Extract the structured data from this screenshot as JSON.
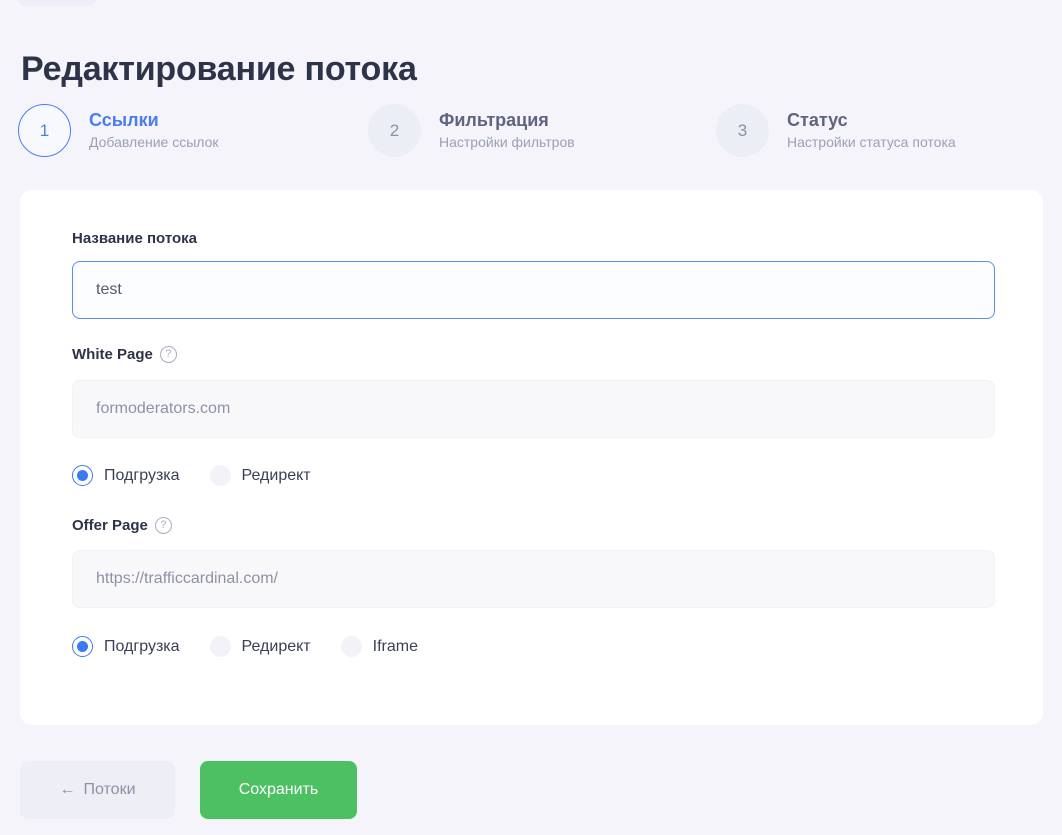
{
  "page": {
    "title": "Редактирование потока",
    "background_color": "#f4f4fa",
    "card_color": "#ffffff"
  },
  "stepper": {
    "steps": [
      {
        "number": "1",
        "title": "Ссылки",
        "subtitle": "Добавление ссылок",
        "state": "active",
        "accent_color": "#4a7ef0"
      },
      {
        "number": "2",
        "title": "Фильтрация",
        "subtitle": "Настройки фильтров",
        "state": "inactive",
        "accent_color": "#8b90a6"
      },
      {
        "number": "3",
        "title": "Статус",
        "subtitle": "Настройки статуса потока",
        "state": "inactive",
        "accent_color": "#8b90a6"
      }
    ]
  },
  "form": {
    "flow_name": {
      "label": "Название потока",
      "value": "test",
      "placeholder": "Название потока",
      "focused": true
    },
    "white_page": {
      "label": "White Page",
      "help_icon": "question-circle-icon",
      "value": "formoderators.com",
      "placeholder": "formoderators.com",
      "focused": false,
      "mode_options": [
        {
          "label": "Подгрузка",
          "selected": true
        },
        {
          "label": "Редирект",
          "selected": false
        }
      ]
    },
    "offer_page": {
      "label": "Offer Page",
      "help_icon": "question-circle-icon",
      "value": "https://trafficcardinal.com/",
      "placeholder": "https://trafficcardinal.com/",
      "focused": false,
      "mode_options": [
        {
          "label": "Подгрузка",
          "selected": true
        },
        {
          "label": "Редирект",
          "selected": false
        },
        {
          "label": "Iframe",
          "selected": false
        }
      ]
    }
  },
  "footer": {
    "back_button": {
      "label": "Потоки",
      "arrow": "←",
      "color": "#eeeef6"
    },
    "save_button": {
      "label": "Сохранить",
      "color": "#4dc161"
    }
  },
  "icons": {
    "help": "?"
  }
}
